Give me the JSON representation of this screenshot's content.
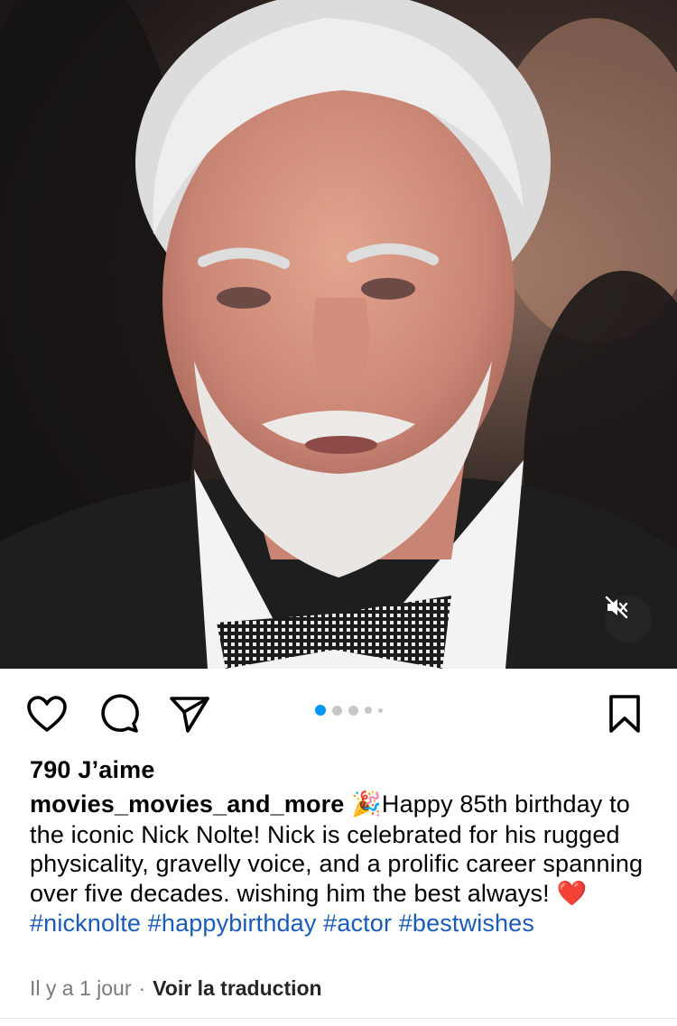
{
  "post": {
    "media": {
      "description_icon": "mute-icon",
      "carousel_count": 5,
      "carousel_active": 0
    },
    "actions": {
      "like_icon": "heart-icon",
      "comment_icon": "comment-icon",
      "share_icon": "send-icon",
      "save_icon": "bookmark-icon"
    },
    "likes_text": "790 J’aime",
    "caption": {
      "username": "movies_movies_and_more",
      "emoji_1": "🎉",
      "text": "Happy 85th birthday to the iconic Nick Nolte! Nick is celebrated for his rugged physicality, gravelly voice, and a prolific career spanning over five decades. wishing him the best always!",
      "emoji_2": "❤️",
      "hashtags": [
        "#nicknolte",
        "#happybirthday",
        "#actor",
        "#bestwishes"
      ]
    },
    "meta": {
      "timestamp": "Il y a 1 jour",
      "separator": "·",
      "translate_label": "Voir la traduction"
    },
    "colors": {
      "hashtag": "#1a5bb8",
      "active_dot": "#0095f6",
      "heart_emoji": "#e0182d"
    }
  }
}
